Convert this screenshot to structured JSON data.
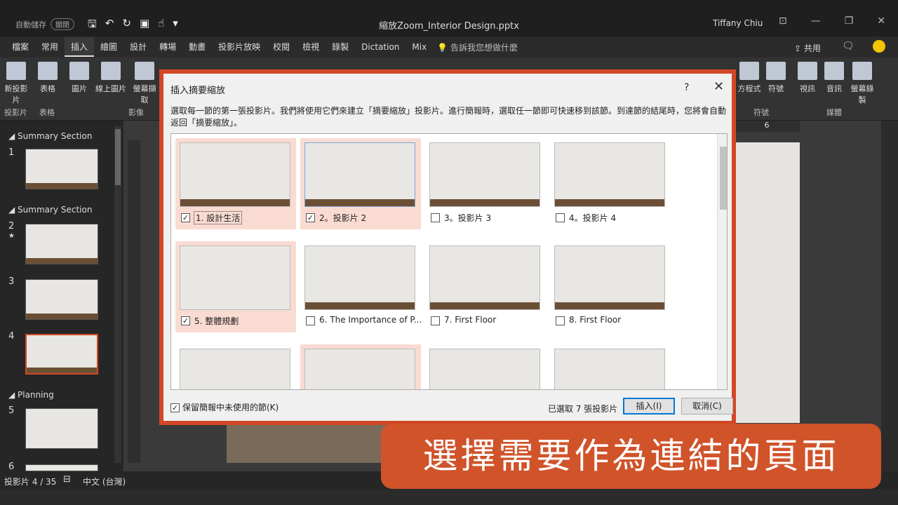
{
  "titlebar": {
    "autosave": "自動儲存",
    "autosave_state": "關閉",
    "doc_title": "縮放Zoom_Interior Design.pptx",
    "user": "Tiffany Chiu"
  },
  "tabs": [
    "檔案",
    "常用",
    "插入",
    "繪圖",
    "設計",
    "轉場",
    "動畫",
    "投影片放映",
    "校閱",
    "檢視",
    "錄製",
    "Dictation",
    "Mix"
  ],
  "active_tab": "插入",
  "tellme": "告訴我您想做什麼",
  "share": "共用",
  "ribbon": {
    "new_slide": "新投影片",
    "table": "表格",
    "picture": "圖片",
    "online_picture": "線上圖片",
    "screenshot": "螢幕擷取",
    "equation": "方程式",
    "symbol": "符號",
    "video": "視訊",
    "audio": "音訊",
    "screen_record": "螢幕錄製",
    "group_slides": "投影片",
    "group_table": "表格",
    "group_images": "影像",
    "group_symbols": "符號",
    "group_media": "媒體"
  },
  "slide_panel": {
    "sections": [
      "Summary Section",
      "Summary Section",
      "Planning"
    ],
    "slides": [
      "1",
      "2",
      "3",
      "4",
      "5",
      "6"
    ],
    "star": "★"
  },
  "ruler_mark": "6",
  "status": {
    "slide": "投影片 4 / 35",
    "lang": "中文 (台灣)"
  },
  "dialog": {
    "title": "插入摘要縮放",
    "help": "?",
    "close": "✕",
    "description": "選取每一節的第一張投影片。我們將使用它們來建立「摘要縮放」投影片。進行簡報時，選取任一節即可快速移到該節。到達節的結尾時，您將會自動返回「摘要縮放」。",
    "cards": [
      {
        "label": "1. 設計生活",
        "checked": "✓"
      },
      {
        "label": "2。投影片 2",
        "checked": "✓"
      },
      {
        "label": "3。投影片 3",
        "checked": ""
      },
      {
        "label": "4。投影片 4",
        "checked": ""
      },
      {
        "label": "5. 整體規劃",
        "checked": "✓"
      },
      {
        "label": "6. The Importance of P...",
        "checked": ""
      },
      {
        "label": "7. First Floor",
        "checked": ""
      },
      {
        "label": "8. First Floor",
        "checked": ""
      }
    ],
    "keep_label": "保留簡報中未使用的節(K)",
    "keep_checked": "✓",
    "selected_count": "已選取 7 張投影片",
    "insert_button": "插入(I)",
    "cancel_button": "取消(C)"
  },
  "caption": "選擇需要作為連結的頁面"
}
